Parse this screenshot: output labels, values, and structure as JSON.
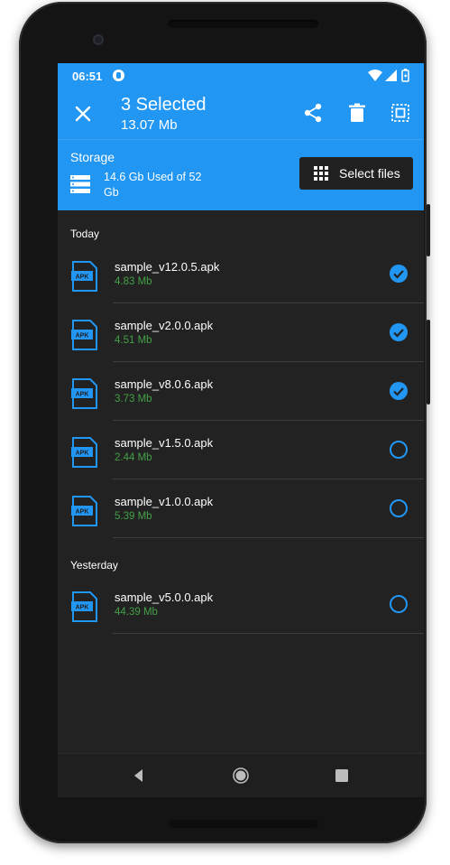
{
  "status_bar": {
    "time": "06:51"
  },
  "toolbar": {
    "title": "3 Selected",
    "subtitle": "13.07 Mb"
  },
  "storage": {
    "label": "Storage",
    "used": "14.6 Gb Used of 52 Gb",
    "select_button": "Select files"
  },
  "sections": [
    {
      "label": "Today",
      "items": [
        {
          "name": "sample_v12.0.5.apk",
          "size": "4.83 Mb",
          "selected": true
        },
        {
          "name": "sample_v2.0.0.apk",
          "size": "4.51 Mb",
          "selected": true
        },
        {
          "name": "sample_v8.0.6.apk",
          "size": "3.73 Mb",
          "selected": true
        },
        {
          "name": "sample_v1.5.0.apk",
          "size": "2.44 Mb",
          "selected": false
        },
        {
          "name": "sample_v1.0.0.apk",
          "size": "5.39 Mb",
          "selected": false
        }
      ]
    },
    {
      "label": "Yesterday",
      "items": [
        {
          "name": "sample_v5.0.0.apk",
          "size": "44.39 Mb",
          "selected": false
        }
      ]
    }
  ],
  "file_icon_label": "APK",
  "colors": {
    "accent": "#2196f3",
    "background": "#222222",
    "size_text": "#43a047"
  }
}
